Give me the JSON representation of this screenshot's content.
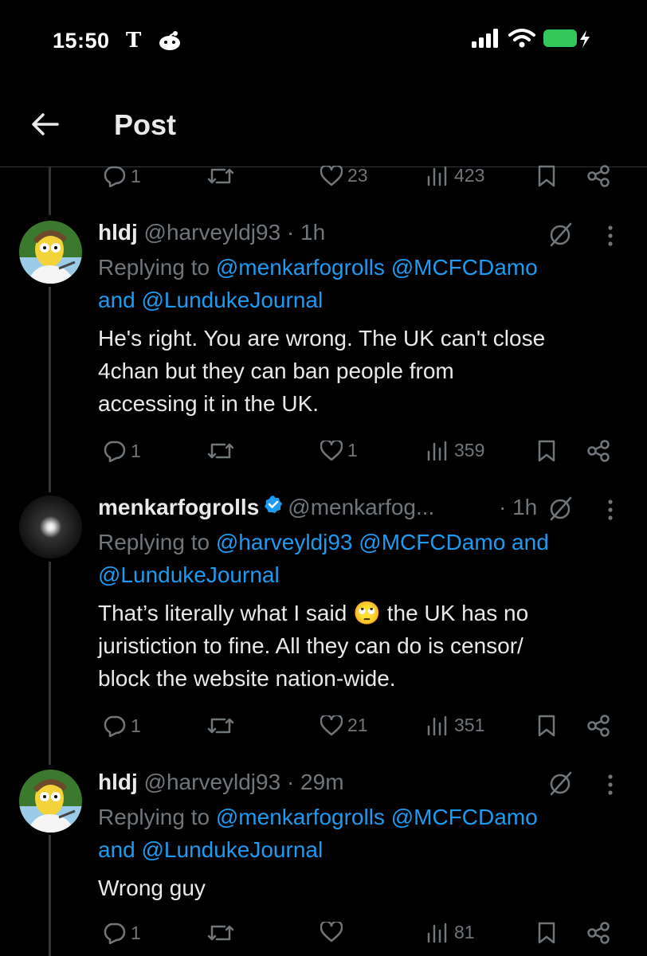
{
  "status_bar": {
    "time": "15:50",
    "nyt_icon": "T"
  },
  "header": {
    "title": "Post"
  },
  "top_actions": {
    "replies": "1",
    "reposts": "",
    "likes": "23",
    "views": "423"
  },
  "tweets": [
    {
      "name": "hldj",
      "handle": "@harveyldj93",
      "time": "· 1h",
      "reply_prefix": "Replying to",
      "reply_line1": "@menkarfogrolls @MCFCDamo",
      "reply_and": "and",
      "reply_line2_handle": "@LundukeJournal",
      "body": [
        "He's right. You are wrong. The UK can't close",
        "4chan but they can ban people from",
        "accessing it in the UK."
      ],
      "actions": {
        "replies": "1",
        "reposts": "",
        "likes": "1",
        "views": "359"
      }
    },
    {
      "name": "menkarfogrolls",
      "handle": "@menkarfog...",
      "time": "· 1h",
      "reply_prefix": "Replying to",
      "reply_line1": "@harveyldj93 @MCFCDamo",
      "reply_and": "and",
      "reply_line2_handle": "@LundukeJournal",
      "body_line1_a": "That’s literally what I said",
      "body_emoji": "🙄",
      "body_line1_b": "the UK has no",
      "body": [
        "juristiction to fine. All they can do is censor/",
        "block the website nation-wide."
      ],
      "actions": {
        "replies": "1",
        "reposts": "",
        "likes": "21",
        "views": "351"
      }
    },
    {
      "name": "hldj",
      "handle": "@harveyldj93",
      "time": "· 29m",
      "reply_prefix": "Replying to",
      "reply_line1": "@menkarfogrolls @MCFCDamo",
      "reply_and": "and",
      "reply_line2_handle": "@LundukeJournal",
      "body": [
        "Wrong guy"
      ],
      "actions": {
        "replies": "1",
        "reposts": "",
        "likes": "",
        "views": "81"
      }
    }
  ]
}
